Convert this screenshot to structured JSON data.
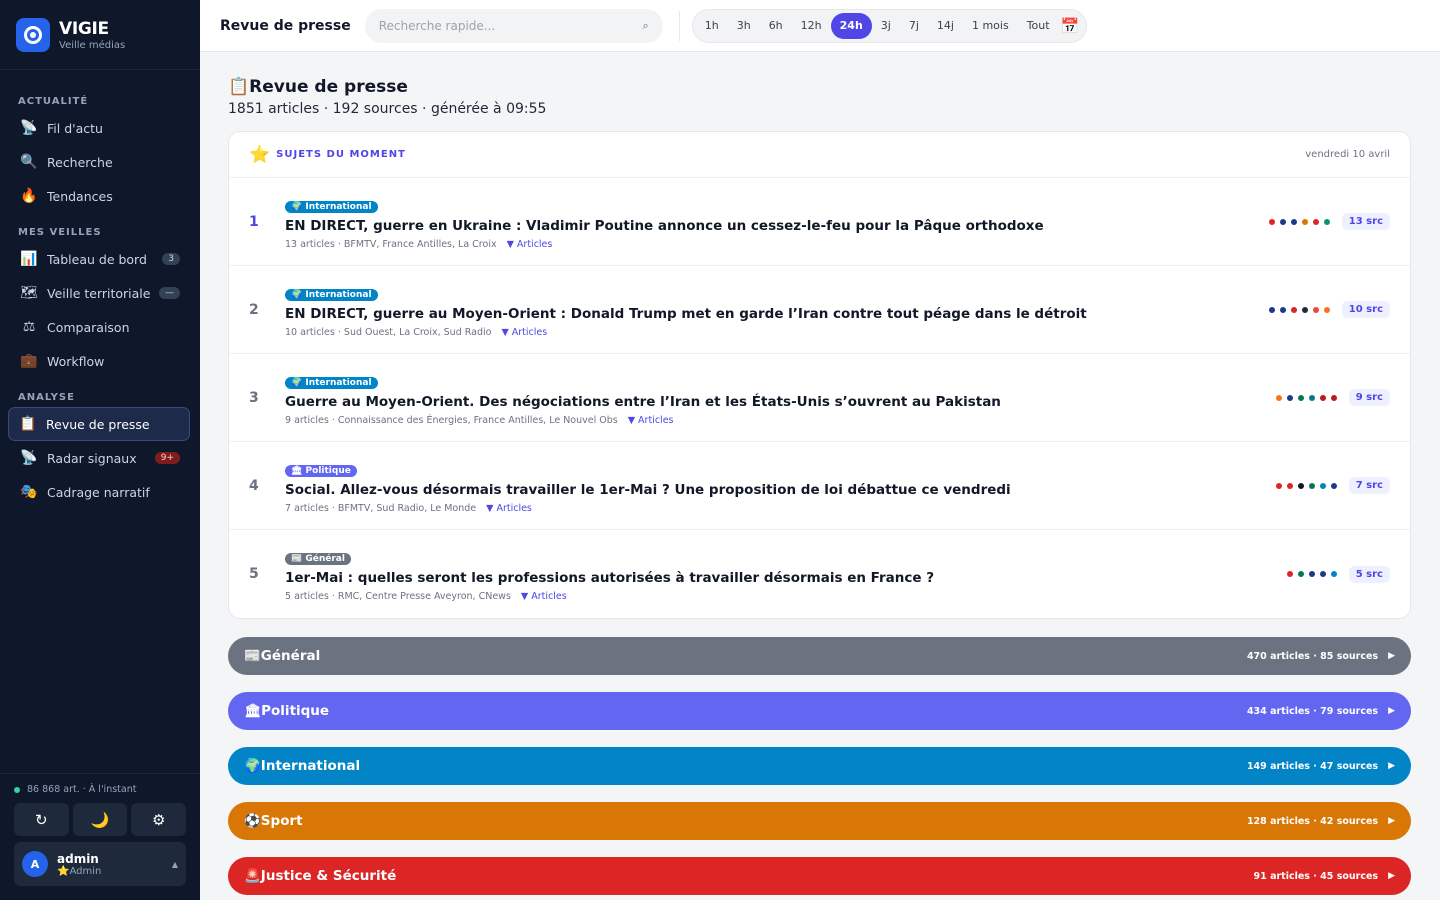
{
  "brand": {
    "name": "VIGIE",
    "subtitle": "Veille médias"
  },
  "sidebar": {
    "sections": [
      {
        "label": "ACTUALITÉ",
        "items": [
          {
            "icon": "📡",
            "label": "Fil d'actu"
          },
          {
            "icon": "🔍",
            "label": "Recherche"
          },
          {
            "icon": "🔥",
            "label": "Tendances"
          }
        ]
      },
      {
        "label": "MES VEILLES",
        "items": [
          {
            "icon": "📊",
            "label": "Tableau de bord",
            "badge": "3"
          },
          {
            "icon": "🗺",
            "label": "Veille territoriale",
            "badge": "—"
          },
          {
            "icon": "⚖",
            "label": "Comparaison"
          },
          {
            "icon": "💼",
            "label": "Workflow"
          }
        ]
      },
      {
        "label": "ANALYSE",
        "items": [
          {
            "icon": "📋",
            "label": "Revue de presse",
            "active": true
          },
          {
            "icon": "📡",
            "label": "Radar signaux",
            "badge": "9+"
          },
          {
            "icon": "🎭",
            "label": "Cadrage narratif"
          }
        ]
      }
    ],
    "status": "86 868 art. · À l'instant",
    "buttons": {
      "refresh": "↻",
      "theme": "🌙",
      "settings": "⚙"
    },
    "user": {
      "initial": "A",
      "name": "admin",
      "role": "⭐Admin",
      "caret": "▲"
    }
  },
  "topbar": {
    "title": "Revue de presse",
    "search_placeholder": "Recherche rapide...",
    "search_icon": "⌕",
    "periods": [
      "1h",
      "3h",
      "6h",
      "12h",
      "24h",
      "3j",
      "7j",
      "14j",
      "1 mois",
      "Tout"
    ],
    "active_period": "24h",
    "calendar_icon": "📅"
  },
  "page": {
    "icon": "📋",
    "title": "Revue de presse",
    "meta": "1851 articles · 192 sources · générée à 09:55"
  },
  "hot": {
    "icon": "⭐",
    "title": "SUJETS DU MOMENT",
    "date": "vendredi 10 avril",
    "topics": [
      {
        "rank": "1",
        "tag": "🌍 International",
        "tag_type": "intl",
        "title": "EN DIRECT, guerre en Ukraine : Vladimir Poutine annonce un cessez-le-feu pour la Pâque orthodoxe",
        "meta": "13 articles · BFMTV, France Antilles, La Croix",
        "link": "▼ Articles",
        "src": "13 src",
        "dots": [
          "#dc2626",
          "#1e3a8a",
          "#1e3a8a",
          "#d97706",
          "#dc2626",
          "#059669"
        ]
      },
      {
        "rank": "2",
        "tag": "🌍 International",
        "tag_type": "intl",
        "title": "EN DIRECT, guerre au Moyen-Orient : Donald Trump met en garde l’Iran contre tout péage dans le détroit",
        "meta": "10 articles · Sud Ouest, La Croix, Sud Radio",
        "link": "▼ Articles",
        "src": "10 src",
        "dots": [
          "#1e3a8a",
          "#1e3a8a",
          "#dc2626",
          "#1e293b",
          "#ef4444",
          "#f97316"
        ]
      },
      {
        "rank": "3",
        "tag": "🌍 International",
        "tag_type": "intl",
        "title": "Guerre au Moyen-Orient. Des négociations entre l’Iran et les États-Unis s’ouvrent au Pakistan",
        "meta": "9 articles · Connaissance des Énergies, France Antilles, Le Nouvel Obs",
        "link": "▼ Articles",
        "src": "9 src",
        "dots": [
          "#f97316",
          "#1e3a8a",
          "#047857",
          "#0e7490",
          "#b91c1c",
          "#b91c1c"
        ]
      },
      {
        "rank": "4",
        "tag": "🏛 Politique",
        "tag_type": "pol",
        "title": "Social. Allez-vous désormais travailler le 1er-Mai ? Une proposition de loi débattue ce vendredi",
        "meta": "7 articles · BFMTV, Sud Radio, Le Monde",
        "link": "▼ Articles",
        "src": "7 src",
        "dots": [
          "#dc2626",
          "#dc2626",
          "#111827",
          "#047857",
          "#0284c7",
          "#1e3a8a"
        ]
      },
      {
        "rank": "5",
        "tag": "📰 Général",
        "tag_type": "gen",
        "title": "1er-Mai : quelles seront les professions autorisées à travailler désormais en France ?",
        "meta": "5 articles · RMC, Centre Presse Aveyron, CNews",
        "link": "▼ Articles",
        "src": "5 src",
        "dots": [
          "#dc2626",
          "#047857",
          "#1e3a8a",
          "#1e3a8a",
          "#0284c7"
        ]
      }
    ]
  },
  "categories": [
    {
      "name": "📰Général",
      "meta": "470 articles · 85 sources",
      "color": "#6b7280"
    },
    {
      "name": "🏛Politique",
      "meta": "434 articles · 79 sources",
      "color": "#6366f1"
    },
    {
      "name": "🌍International",
      "meta": "149 articles · 47 sources",
      "color": "#0284c7"
    },
    {
      "name": "⚽Sport",
      "meta": "128 articles · 42 sources",
      "color": "#d97706"
    },
    {
      "name": "🚨Justice & Sécurité",
      "meta": "91 articles · 45 sources",
      "color": "#dc2626"
    }
  ]
}
